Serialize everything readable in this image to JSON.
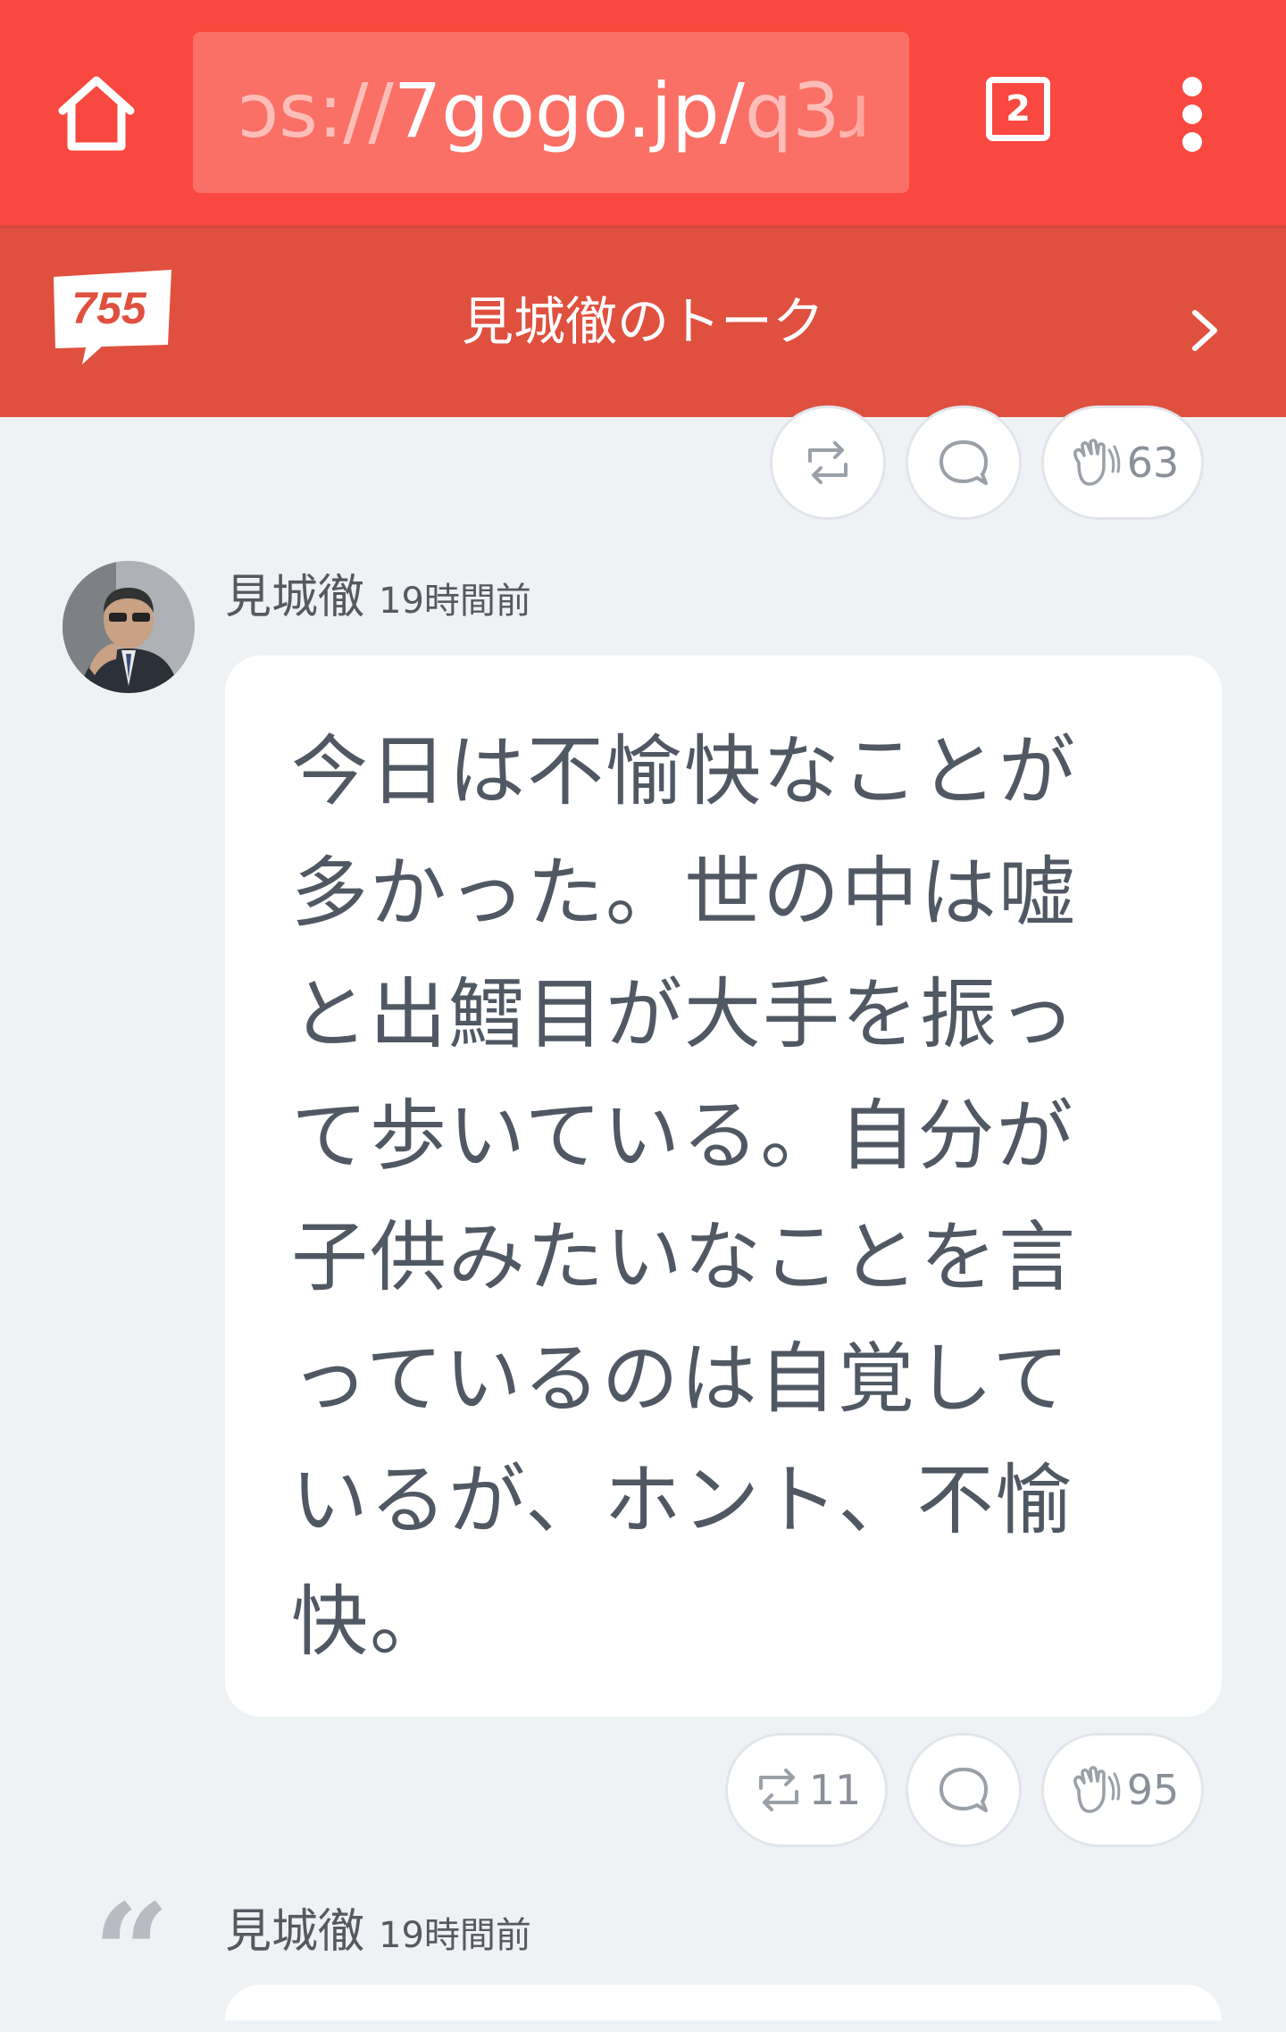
{
  "browser": {
    "url_faded_prefix": "ɔs://",
    "url_main": "7gogo.jp/",
    "url_tail": "q3ɹ",
    "tab_count": "2"
  },
  "site": {
    "logo_text": "755",
    "talk_title": "見城徹のトーク"
  },
  "top_actions": {
    "clap_count": "63"
  },
  "post": {
    "author": "見城徹",
    "time": "19時間前",
    "body": "今日は不愉快なことが多かった。世の中は嘘と出鱈目が大手を振って歩いている。自分が子供みたいなことを言っているのは自覚しているが、ホント、不愉快。",
    "repost_count": "11",
    "clap_count": "95"
  },
  "next_post": {
    "quote_glyph": "“",
    "author": "見城徹",
    "time": "19時間前"
  },
  "colors": {
    "browser_bar": "#f9483f",
    "site_header": "#e0503f",
    "page_bg": "#eff2f5",
    "text": "#4f5863"
  }
}
